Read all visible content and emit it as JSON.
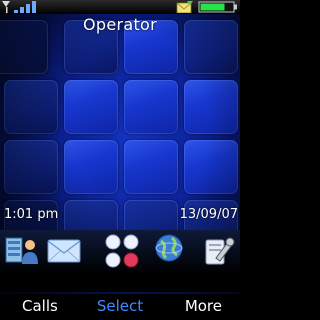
{
  "status": {
    "signal_bars": 4,
    "battery_level": 0.75,
    "envelope_icon": "message-envelope-icon"
  },
  "operator": "Operator",
  "clock": {
    "time": "1:01 pm",
    "date": "13/09/07"
  },
  "shortcuts": [
    {
      "name": "contacts-shortcut",
      "icon": "contacts-icon"
    },
    {
      "name": "messaging-shortcut",
      "icon": "envelope-icon"
    },
    {
      "name": "menu-shortcut",
      "icon": "four-dots-icon"
    },
    {
      "name": "internet-shortcut",
      "icon": "globe-icon"
    },
    {
      "name": "settings-shortcut",
      "icon": "wrench-icon"
    }
  ],
  "softkeys": {
    "left": "Calls",
    "center": "Select",
    "right": "More"
  },
  "colors": {
    "accent": "#3d8cff",
    "wallpaper": "#1535c8",
    "battery": "#27e34a"
  }
}
